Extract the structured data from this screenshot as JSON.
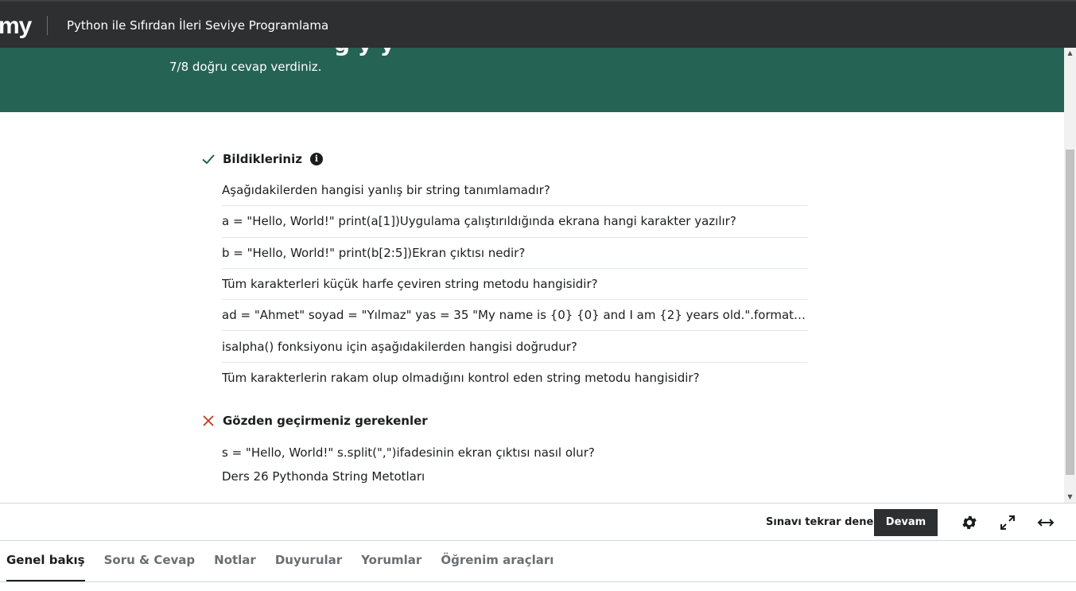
{
  "header": {
    "logo_text": "my",
    "course_title": "Python ile Sıfırdan İleri Seviye Programlama"
  },
  "banner": {
    "heading_clipped": "g  y  y",
    "score_text": "7/8 doğru cevap verdiniz.",
    "background_color": "#256355"
  },
  "known_section": {
    "title": "Bildikleriniz",
    "icon": "checkmark-icon",
    "icon_color": "#1e6055",
    "info_icon": "i",
    "questions": [
      "Aşağıdakilerden hangisi yanlış bir string tanımlamadır?",
      "a = \"Hello, World!\" print(a[1])Uygulama çalıştırıldığında ekrana hangi karakter yazılır?",
      "b = \"Hello, World!\" print(b[2:5])Ekran çıktısı nedir?",
      "Tüm karakterleri küçük harfe çeviren string metodu hangisidir?",
      "ad = \"Ahmet\" soyad = \"Yılmaz\" yas = 35 \"My name is {0} {0} and I am {2} years old.\".format(ad,soyad,yas)",
      "isalpha() fonksiyonu için aşağıdakilerden hangisi doğrudur?",
      "Tüm karakterlerin rakam olup olmadığını kontrol eden string metodu hangisidir?"
    ]
  },
  "review_section": {
    "title": "Gözden geçirmeniz gerekenler",
    "icon": "x-icon",
    "icon_color": "#c4391c",
    "question": "s = \"Hello, World!\" s.split(\",\")ifadesinin ekran çıktısı nasıl olur?",
    "lesson": "Ders 26 Pythonda String Metotları"
  },
  "actions": {
    "retry_label": "Sınavı tekrar dene",
    "continue_label": "Devam",
    "settings_icon": "gear-icon",
    "fullscreen_icon": "expand-icon",
    "wide_icon": "arrows-horizontal-icon"
  },
  "tabs": [
    {
      "label": "Genel bakış",
      "active": true
    },
    {
      "label": "Soru & Cevap",
      "active": false
    },
    {
      "label": "Notlar",
      "active": false
    },
    {
      "label": "Duyurular",
      "active": false
    },
    {
      "label": "Yorumlar",
      "active": false
    },
    {
      "label": "Öğrenim araçları",
      "active": false
    }
  ]
}
